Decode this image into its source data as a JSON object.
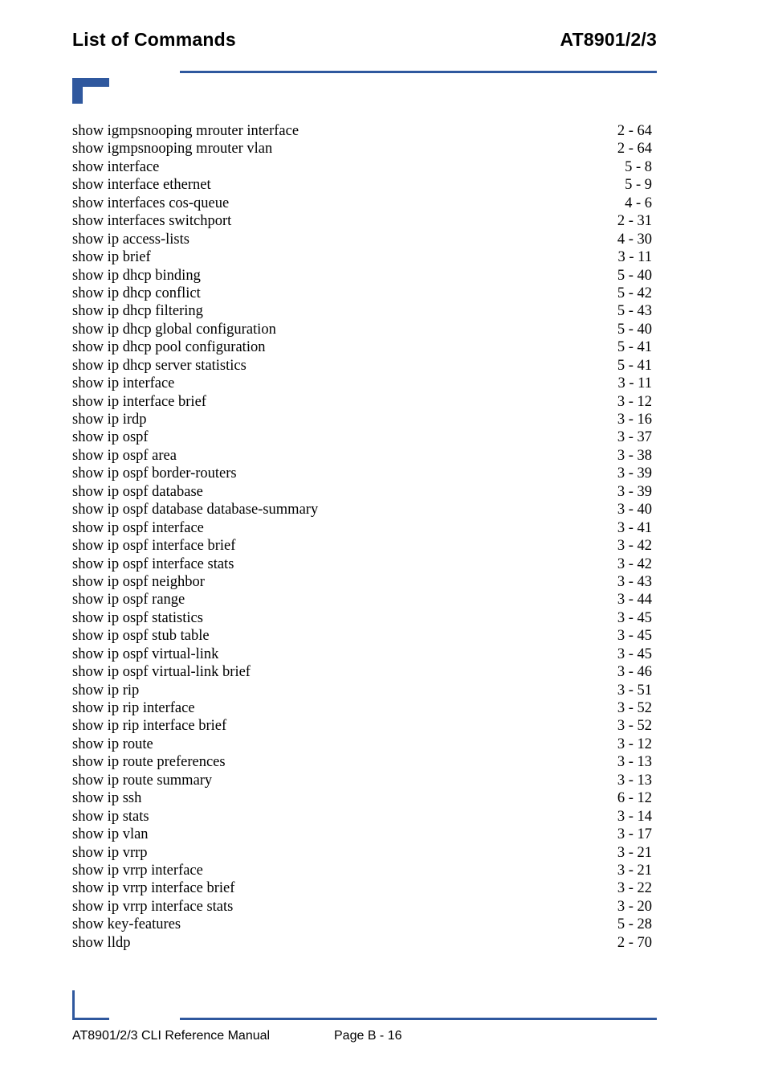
{
  "header": {
    "title": "List of Commands",
    "model": "AT8901/2/3"
  },
  "colors": {
    "accent_blue": "#2F589E",
    "text": "#000000",
    "background": "#FFFFFF"
  },
  "index": {
    "entries": [
      {
        "command": "show igmpsnooping mrouter interface",
        "page": "2 - 64"
      },
      {
        "command": "show igmpsnooping mrouter vlan",
        "page": "2 - 64"
      },
      {
        "command": "show interface",
        "page": "5 - 8"
      },
      {
        "command": "show interface ethernet",
        "page": "5 - 9"
      },
      {
        "command": "show interfaces cos-queue",
        "page": "4 - 6"
      },
      {
        "command": "show interfaces switchport",
        "page": "2 - 31"
      },
      {
        "command": "show ip access-lists",
        "page": "4 - 30"
      },
      {
        "command": "show ip brief",
        "page": "3 - 11"
      },
      {
        "command": "show ip dhcp binding",
        "page": "5 - 40"
      },
      {
        "command": "show ip dhcp conflict",
        "page": "5 - 42"
      },
      {
        "command": "show ip dhcp filtering",
        "page": "5 - 43"
      },
      {
        "command": "show ip dhcp global configuration",
        "page": "5 - 40"
      },
      {
        "command": "show ip dhcp pool configuration",
        "page": "5 - 41"
      },
      {
        "command": "show ip dhcp server statistics",
        "page": "5 - 41"
      },
      {
        "command": "show ip interface",
        "page": "3 - 11"
      },
      {
        "command": "show ip interface brief",
        "page": "3 - 12"
      },
      {
        "command": "show ip irdp",
        "page": "3 - 16"
      },
      {
        "command": "show ip ospf",
        "page": "3 - 37"
      },
      {
        "command": "show ip ospf area",
        "page": "3 - 38"
      },
      {
        "command": "show ip ospf border-routers",
        "page": "3 - 39"
      },
      {
        "command": "show ip ospf database",
        "page": "3 - 39"
      },
      {
        "command": "show ip ospf database database-summary",
        "page": "3 - 40"
      },
      {
        "command": "show ip ospf interface",
        "page": "3 - 41"
      },
      {
        "command": "show ip ospf interface brief",
        "page": "3 - 42"
      },
      {
        "command": "show ip ospf interface stats",
        "page": "3 - 42"
      },
      {
        "command": "show ip ospf neighbor",
        "page": "3 - 43"
      },
      {
        "command": "show ip ospf range",
        "page": "3 - 44"
      },
      {
        "command": "show ip ospf statistics",
        "page": "3 - 45"
      },
      {
        "command": "show ip ospf stub table",
        "page": "3 - 45"
      },
      {
        "command": "show ip ospf virtual-link",
        "page": "3 - 45"
      },
      {
        "command": "show ip ospf virtual-link brief",
        "page": "3 - 46"
      },
      {
        "command": "show ip rip",
        "page": "3 - 51"
      },
      {
        "command": "show ip rip interface",
        "page": "3 - 52"
      },
      {
        "command": "show ip rip interface brief",
        "page": "3 - 52"
      },
      {
        "command": "show ip route",
        "page": "3 - 12"
      },
      {
        "command": "show ip route preferences",
        "page": "3 - 13"
      },
      {
        "command": "show ip route summary",
        "page": "3 - 13"
      },
      {
        "command": "show ip ssh",
        "page": "6 - 12"
      },
      {
        "command": "show ip stats",
        "page": "3 - 14"
      },
      {
        "command": "show ip vlan",
        "page": "3 - 17"
      },
      {
        "command": "show ip vrrp",
        "page": "3 - 21"
      },
      {
        "command": "show ip vrrp interface",
        "page": "3 - 21"
      },
      {
        "command": "show ip vrrp interface brief",
        "page": "3 - 22"
      },
      {
        "command": "show ip vrrp interface stats",
        "page": "3 - 20"
      },
      {
        "command": "show key-features",
        "page": "5 - 28"
      },
      {
        "command": "show lldp",
        "page": "2 - 70"
      }
    ]
  },
  "footer": {
    "manual": "AT8901/2/3 CLI Reference Manual",
    "page_number": "Page B - 16"
  }
}
